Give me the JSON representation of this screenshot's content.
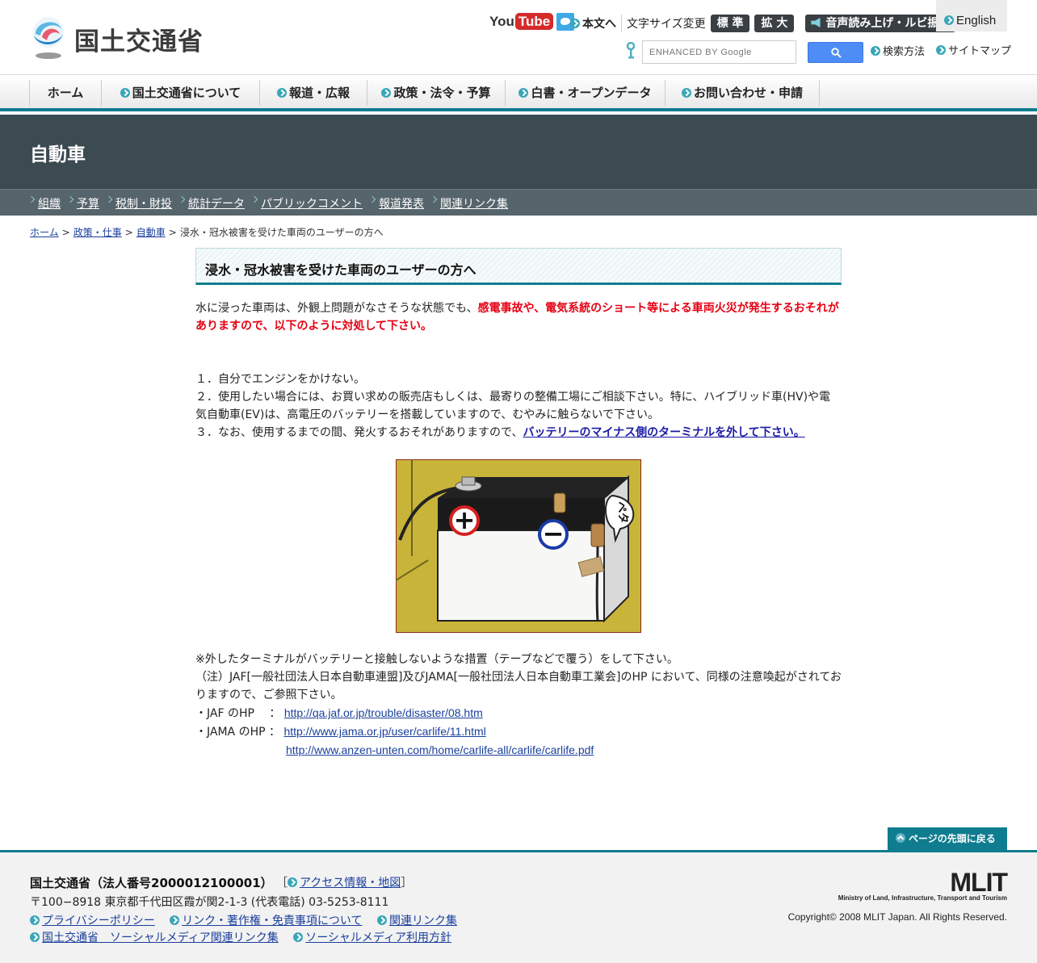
{
  "header": {
    "org_name": "国土交通省",
    "youtube_you": "You",
    "youtube_tube": "Tube",
    "skip_to_main": "本文へ",
    "font_size_label": "文字サイズ変更",
    "font_standard": "標 準",
    "font_large": "拡 大",
    "voice_ruby": "音声読み上げ・ルビ振り",
    "english": "English",
    "search_placeholder": "ENHANCED BY Google",
    "search_method": "検索方法",
    "sitemap": "サイトマップ"
  },
  "global_nav": [
    {
      "label": "ホーム",
      "icon": false
    },
    {
      "label": "国土交通省について",
      "icon": true
    },
    {
      "label": "報道・広報",
      "icon": true
    },
    {
      "label": "政策・法令・予算",
      "icon": true
    },
    {
      "label": "白書・オープンデータ",
      "icon": true
    },
    {
      "label": "お問い合わせ・申請",
      "icon": true
    }
  ],
  "page_title": "自動車",
  "sub_nav": [
    "組織",
    "予算",
    "税制・財投",
    "統計データ",
    "パブリックコメント",
    "報道発表",
    "関連リンク集"
  ],
  "breadcrumb": {
    "home": "ホーム",
    "policy": "政策・仕事",
    "car": "自動車",
    "current": "浸水・冠水被害を受けた車両のユーザーの方へ",
    "sep": ">"
  },
  "main": {
    "heading": "浸水・冠水被害を受けた車両のユーザーの方へ",
    "intro_plain": "水に浸った車両は、外観上問題がなさそうな状態でも、",
    "intro_red": "感電事故や、電気系統のショート等による車両火災が発生するおそれがありますので、以下のように対処して下さい。",
    "item1": "１．自分でエンジンをかけない。",
    "item2": "２．使用したい場合には、お買い求めの販売店もしくは、最寄りの整備工場にご相談下さい。特に、ハイブリッド車(HV)や電気自動車(EV)は、高電圧のバッテリーを搭載していますので、むやみに触らないで下さい。",
    "item3_plain": "３．なお、使用するまでの間、発火するおそれがありますので、",
    "item3_link": "バッテリーのマイナス側のターミナルを外して下さい。",
    "illustration": {
      "plus": "+",
      "minus": "−",
      "tape": "ペタ"
    },
    "note1": "※外したターミナルがバッテリーと接触しないような措置（テープなどで覆う）をして下さい。",
    "note2": "（注）JAF[一般社団法人日本自動車連盟]及びJAMA[一般社団法人日本自動車工業会]のHP において、同様の注意喚起がされておりますので、ご参照下さい。",
    "jaf_label": "・JAF のHP　 ：",
    "jaf_url": "http://qa.jaf.or.jp/trouble/disaster/08.htm",
    "jama_label": "・JAMA のHP ：",
    "jama_url1": "http://www.jama.or.jp/user/carlife/11.html",
    "jama_url2": "http://www.anzen-unten.com/home/carlife-all/carlife/carlife.pdf"
  },
  "back_to_top": "ページの先頭に戻る",
  "footer": {
    "org": "国土交通省（法人番号2000012100001）",
    "bracket_open": "［",
    "bracket_close": "］",
    "access": "アクセス情報・地図",
    "address": "〒100−8918 東京都千代田区霞が関2-1-3 (代表電話) 03-5253-8111",
    "privacy": "プライバシーポリシー",
    "link_copyright": "リンク・著作権・免責事項について",
    "related_links": "関連リンク集",
    "social_links": "国土交通省　ソーシャルメディア関連リンク集",
    "social_policy": "ソーシャルメディア利用方針",
    "mlit_logo": "MLIT",
    "mlit_full": "Ministry of Land, Infrastructure, Transport and Tourism",
    "copyright": "Copyright© 2008 MLIT Japan. All Rights Reserved."
  },
  "colors": {
    "accent": "#0f7c8f",
    "title_band": "#3c4a52",
    "warning_red": "#e60012",
    "link": "#1a3f9c"
  }
}
